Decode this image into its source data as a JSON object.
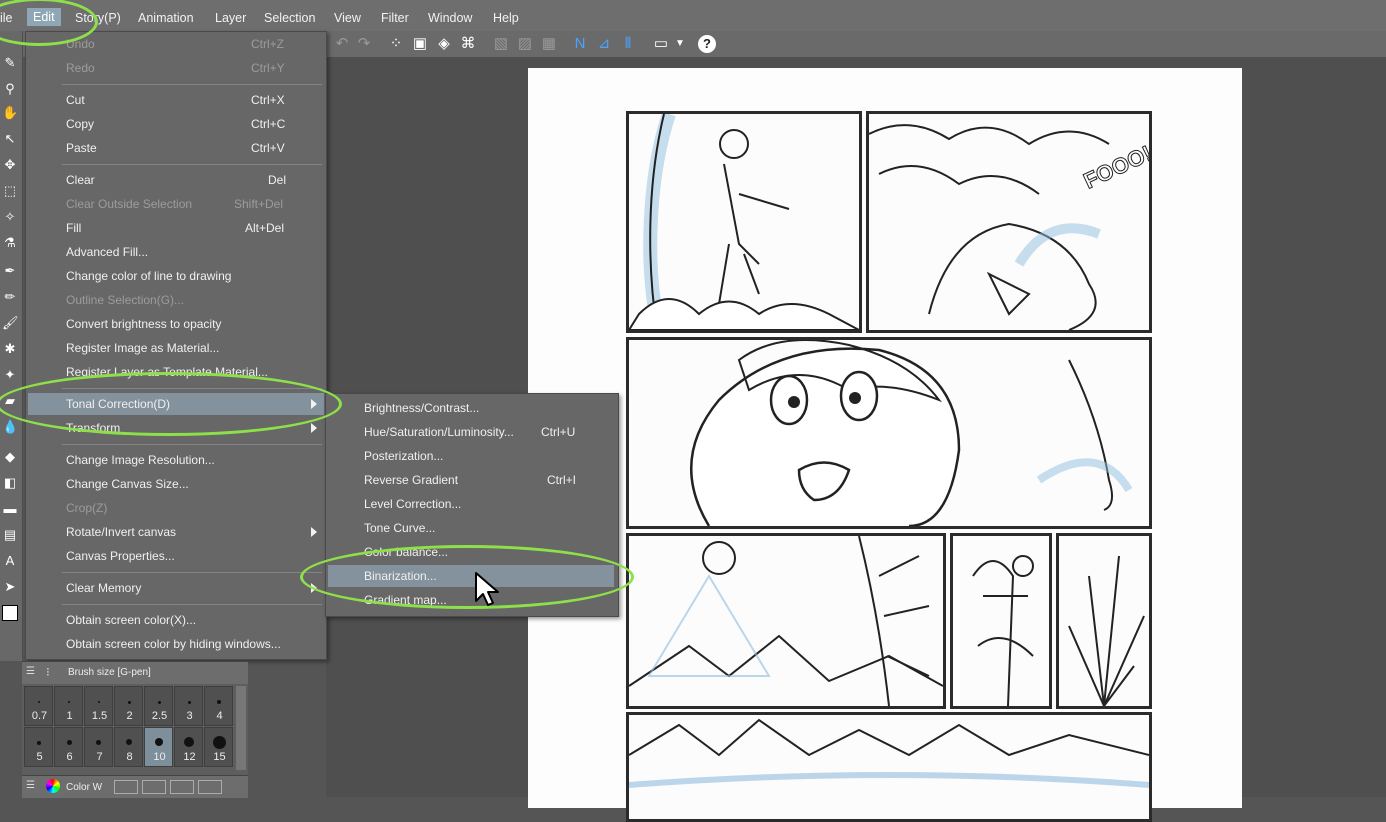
{
  "menubar": {
    "items": [
      {
        "label": "ile"
      },
      {
        "label": "Edit"
      },
      {
        "label": "Story(P)"
      },
      {
        "label": "Animation"
      },
      {
        "label": "Layer"
      },
      {
        "label": "Selection"
      },
      {
        "label": "View"
      },
      {
        "label": "Filter"
      },
      {
        "label": "Window"
      },
      {
        "label": "Help"
      }
    ]
  },
  "toolbar": {
    "help_label": "?"
  },
  "edit_menu": {
    "items": [
      {
        "label": "Undo",
        "shortcut": "Ctrl+Z",
        "disabled": true
      },
      {
        "label": "Redo",
        "shortcut": "Ctrl+Y",
        "disabled": true
      },
      {
        "label": "Cut",
        "shortcut": "Ctrl+X"
      },
      {
        "label": "Copy",
        "shortcut": "Ctrl+C"
      },
      {
        "label": "Paste",
        "shortcut": "Ctrl+V"
      },
      {
        "label": "Clear",
        "shortcut": "Del"
      },
      {
        "label": "Clear Outside Selection",
        "shortcut": "Shift+Del",
        "disabled": true
      },
      {
        "label": "Fill",
        "shortcut": "Alt+Del"
      },
      {
        "label": "Advanced Fill..."
      },
      {
        "label": "Change color of line to drawing"
      },
      {
        "label": "Outline Selection(G)...",
        "disabled": true
      },
      {
        "label": "Convert brightness to opacity"
      },
      {
        "label": "Register Image as Material..."
      },
      {
        "label": "Register Layer as Template Material..."
      },
      {
        "label": "Tonal Correction(D)",
        "submenu": true,
        "highlighted": true
      },
      {
        "label": "Transform",
        "submenu": true
      },
      {
        "label": "Change Image Resolution..."
      },
      {
        "label": "Change Canvas Size..."
      },
      {
        "label": "Crop(Z)",
        "disabled": true
      },
      {
        "label": "Rotate/Invert canvas",
        "submenu": true
      },
      {
        "label": "Canvas Properties..."
      },
      {
        "label": "Clear Memory",
        "submenu": true
      },
      {
        "label": "Obtain screen color(X)..."
      },
      {
        "label": "Obtain screen color by hiding windows..."
      }
    ]
  },
  "tonal_submenu": {
    "items": [
      {
        "label": "Brightness/Contrast..."
      },
      {
        "label": "Hue/Saturation/Luminosity...",
        "shortcut": "Ctrl+U"
      },
      {
        "label": "Posterization..."
      },
      {
        "label": "Reverse Gradient",
        "shortcut": "Ctrl+I"
      },
      {
        "label": "Level Correction..."
      },
      {
        "label": "Tone Curve..."
      },
      {
        "label": "Color balance..."
      },
      {
        "label": "Binarization...",
        "highlighted": true
      },
      {
        "label": "Gradient map..."
      }
    ]
  },
  "brush_panel": {
    "title": "Brush size [G-pen]",
    "sizes": [
      "0.7",
      "1",
      "1.5",
      "2",
      "2.5",
      "3",
      "4",
      "5",
      "6",
      "7",
      "8",
      "10",
      "12",
      "15"
    ],
    "selected": "10"
  },
  "color_panel": {
    "title": "Color W"
  },
  "comic_text": {
    "sfx": "FOOO!"
  },
  "colors": {
    "menu_bg": "#676767",
    "highlight": "#83929c",
    "annotation": "#8ee04a"
  }
}
